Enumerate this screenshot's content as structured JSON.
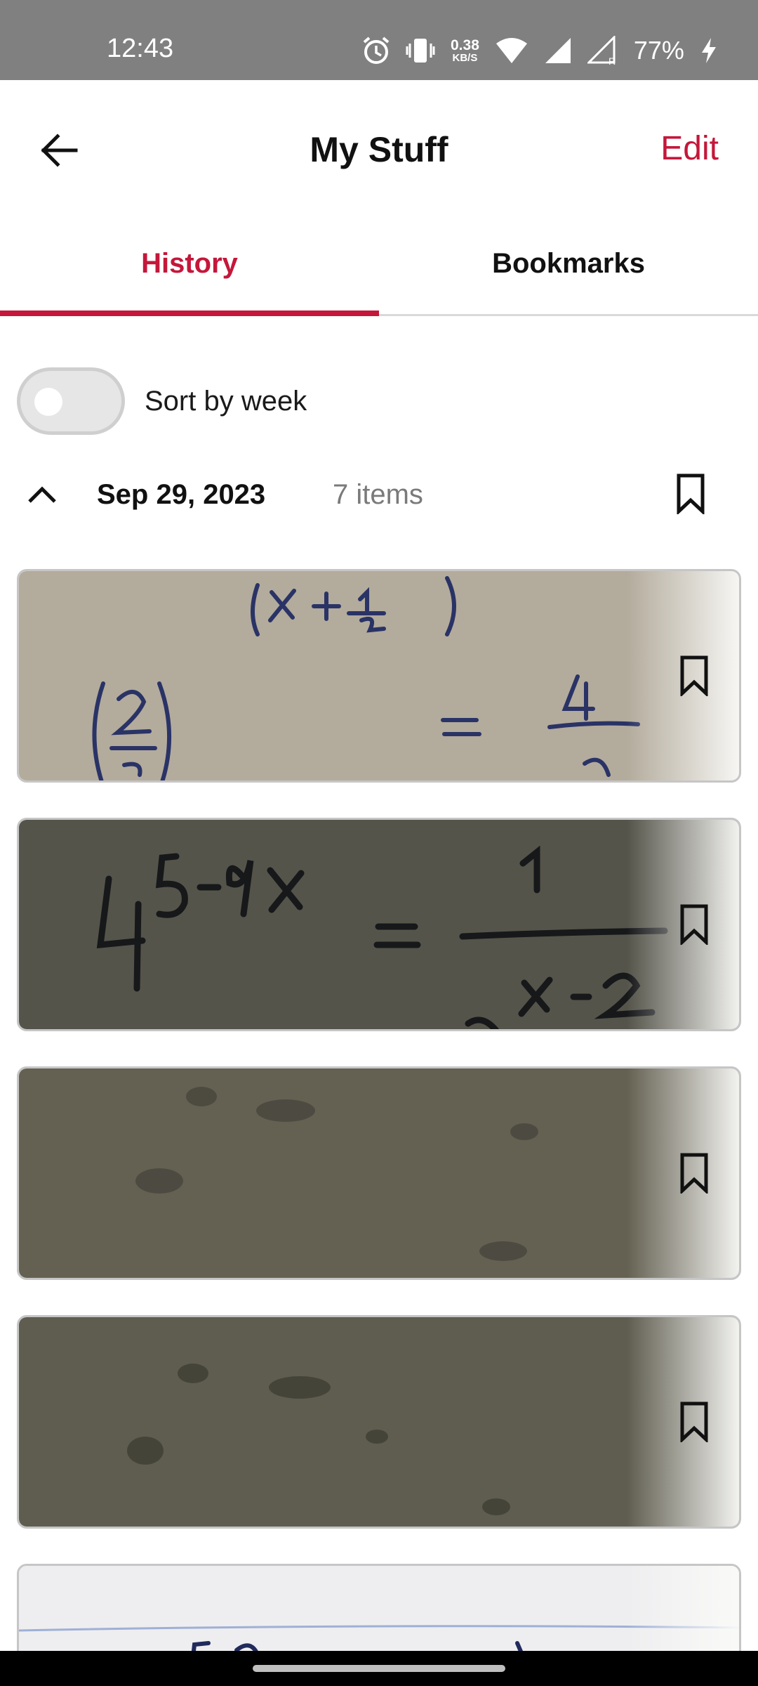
{
  "status_bar": {
    "time": "12:43",
    "net_speed_value": "0.38",
    "net_speed_unit": "KB/S",
    "battery": "77%",
    "icons": [
      "alarm-icon",
      "vibrate-icon",
      "wifi-icon",
      "signal-icon",
      "signal-roaming-icon",
      "charging-icon"
    ]
  },
  "app_bar": {
    "title": "My Stuff",
    "edit_label": "Edit",
    "back_icon": "arrow-left-icon"
  },
  "tabs": [
    {
      "label": "History",
      "active": true
    },
    {
      "label": "Bookmarks",
      "active": false
    }
  ],
  "sort_toggle": {
    "label": "Sort by week",
    "on": false
  },
  "group": {
    "date": "Sep 29, 2023",
    "count": "7 items",
    "expanded": true
  },
  "cards": [
    {
      "math_text": "",
      "bookmarked": false
    },
    {
      "math_text": "",
      "bookmarked": false
    },
    {
      "math_text": "",
      "bookmarked": false
    },
    {
      "math_text": "",
      "bookmarked": false
    },
    {
      "math_text": "",
      "bookmarked": false
    }
  ],
  "colors": {
    "accent": "#c4173a",
    "status_bar_bg": "#808080",
    "muted_text": "#7a7a7a"
  }
}
